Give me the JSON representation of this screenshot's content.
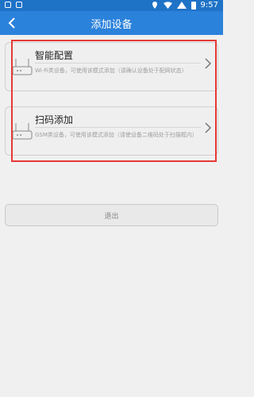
{
  "status": {
    "time": "9:57"
  },
  "header": {
    "title": "添加设备"
  },
  "options": [
    {
      "title": "智能配置",
      "description": "Wi-Fi类设备，可使用该模式添加（请确认设备处于配网状态）"
    },
    {
      "title": "扫码添加",
      "description": "GSM类设备，可使用该模式添加（请使设备二维码处于扫描框内）"
    }
  ],
  "footer": {
    "exit_label": "退出"
  },
  "colors": {
    "header": "#2b82db",
    "status": "#1f73c7",
    "highlight": "#e53935"
  }
}
